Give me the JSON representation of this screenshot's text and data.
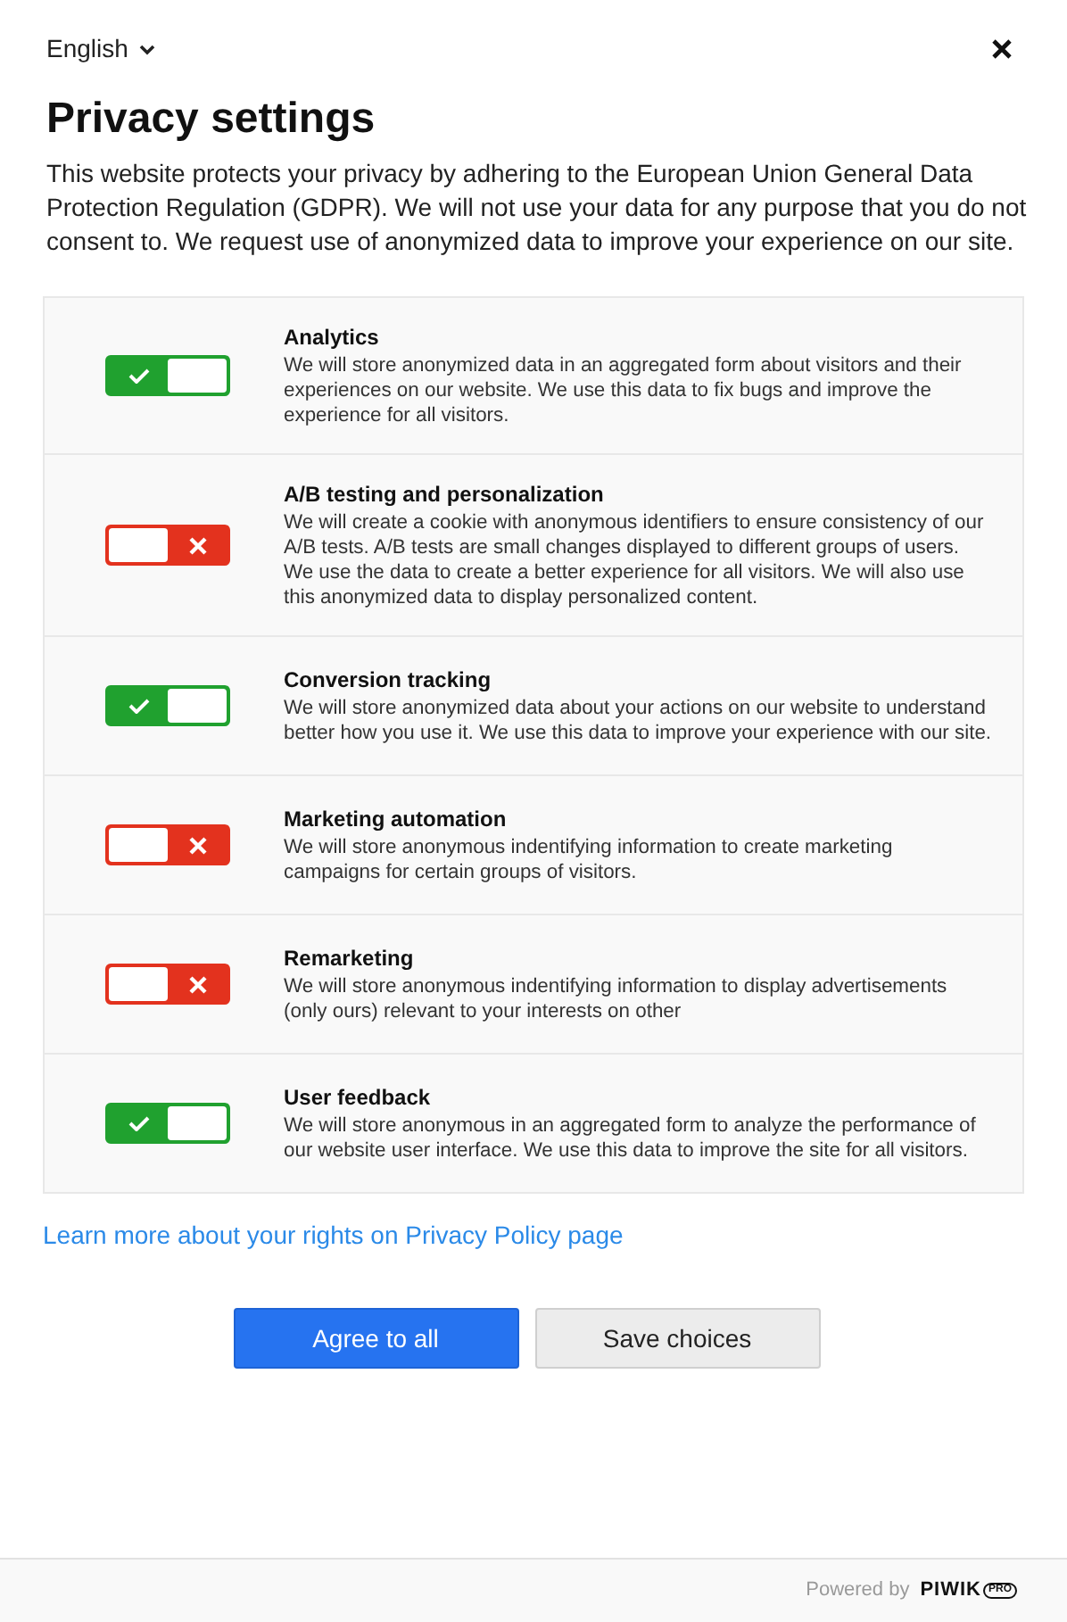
{
  "language": {
    "label": "English"
  },
  "title": "Privacy settings",
  "intro": "This website protects your privacy by adhering to the European Union General Data Protection Regulation (GDPR). We will not use your data for any purpose that you do not consent to. We request use of anonymized data to improve your experience on our site.",
  "consents": [
    {
      "name": "Analytics",
      "description": "We will store anonymized data in an aggregated form about visitors and their experiences on our website. We use this data to fix bugs and improve the experience for all visitors.",
      "checked": true
    },
    {
      "name": "A/B testing and personalization",
      "description": "We will create a cookie with anonymous identifiers to ensure consistency of our A/B tests. A/B tests are small changes displayed to different groups of users. We use the data to create a better experience for all visitors. We will also use this anonymized data to display personalized content.",
      "checked": false
    },
    {
      "name": "Conversion tracking",
      "description": "We will store anonymized data about your actions on our website to understand better how you use it. We use this data to improve your experience with our site.",
      "checked": true
    },
    {
      "name": "Marketing automation",
      "description": "We will store anonymous indentifying information to create marketing campaigns for certain groups of visitors.",
      "checked": false
    },
    {
      "name": "Remarketing",
      "description": "We will store anonymous indentifying information to display advertisements (only ours) relevant to your interests on other",
      "checked": false
    },
    {
      "name": "User feedback",
      "description": "We will store anonymous in an aggregated form to analyze the performance of our website user interface. We use this data to improve the site for all visitors.",
      "checked": true
    }
  ],
  "policy_link": "Learn more about your rights on Privacy Policy page",
  "buttons": [
    {
      "label": "Agree to all",
      "kind": "primary"
    },
    {
      "label": "Save choices",
      "kind": "secondary"
    }
  ],
  "footer": {
    "powered_by": "Powered by",
    "logo_text": "PIWIK",
    "logo_badge": "PRO"
  }
}
